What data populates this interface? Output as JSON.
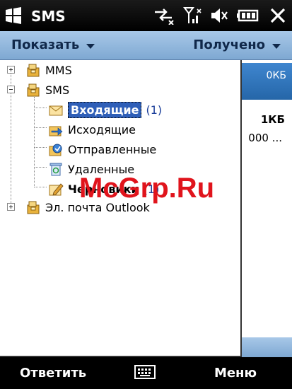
{
  "status_bar": {
    "title": "SMS"
  },
  "menu": {
    "show_label": "Показать",
    "sort_label": "Получено"
  },
  "background_list": {
    "size_selected": "0КБ",
    "size_second": "1КБ",
    "preview_second": "000 ..."
  },
  "tree": {
    "mms_label": "MMS",
    "sms_label": "SMS",
    "inbox_label": "Входящие",
    "inbox_count": "(1)",
    "outbox_label": "Исходящие",
    "sent_label": "Отправленные",
    "deleted_label": "Удаленные",
    "drafts_label": "Черновики",
    "drafts_count": "(1)",
    "outlook_label": "Эл. почта Outlook"
  },
  "watermark": "McGrp.Ru",
  "softkeys": {
    "left": "Ответить",
    "right": "Меню"
  },
  "colors": {
    "menu_bar": "#8fb4dc",
    "selection": "#2f5fb8",
    "count": "#1c3f9a",
    "watermark": "#e0141c"
  }
}
